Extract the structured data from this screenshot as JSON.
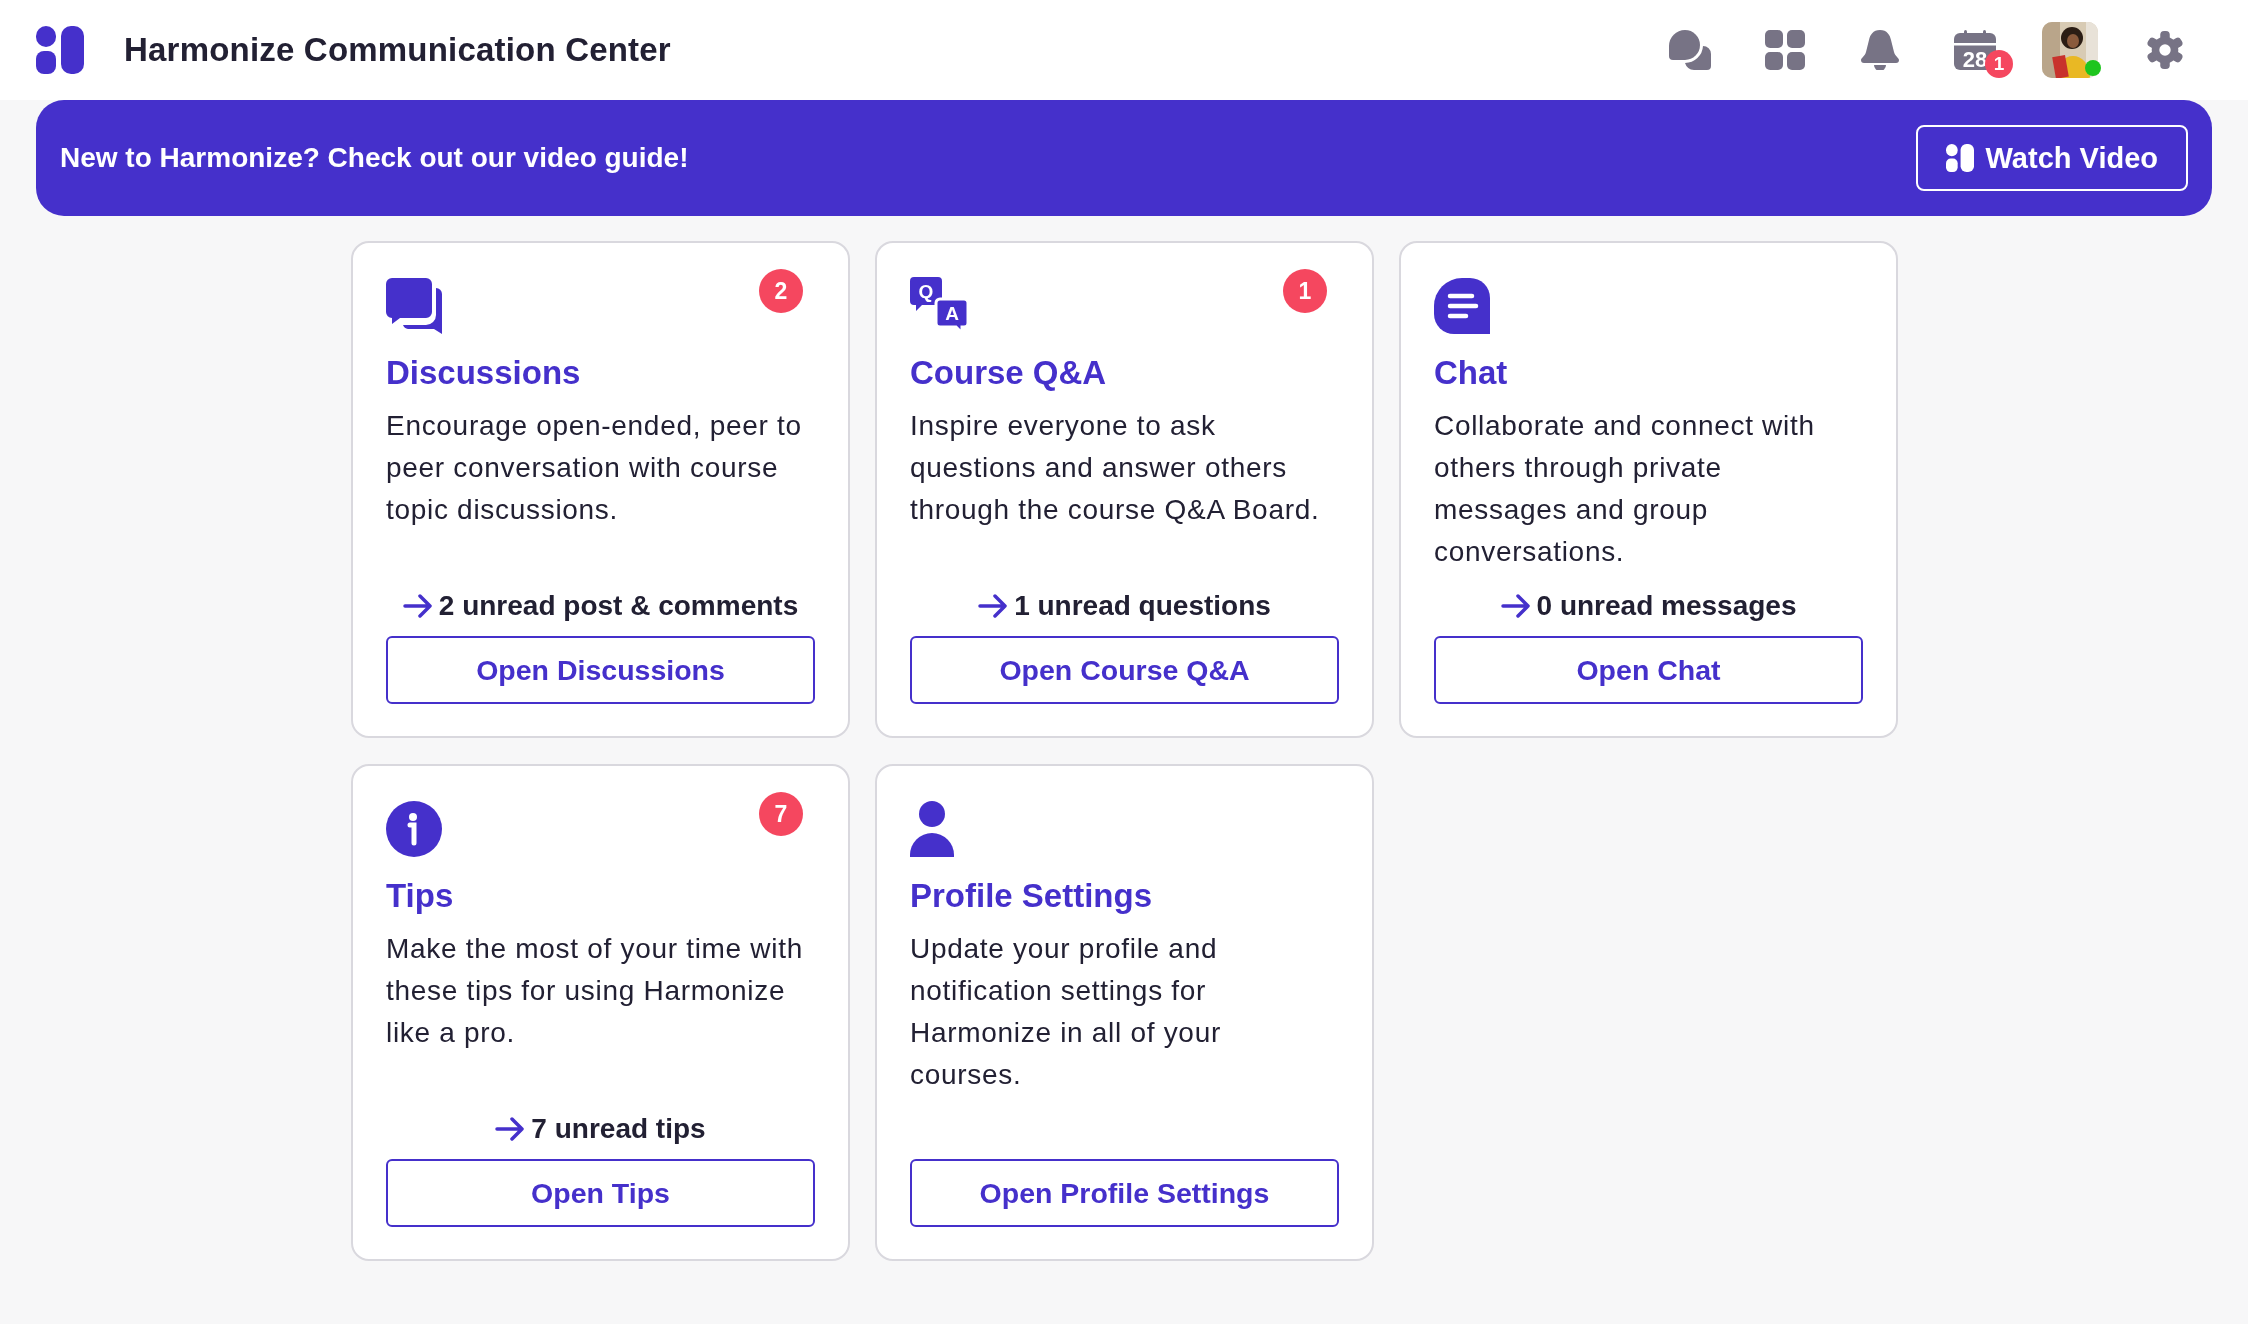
{
  "header": {
    "title": "Harmonize Communication Center",
    "icons": [
      {
        "kind": "chats"
      },
      {
        "kind": "apps"
      },
      {
        "kind": "bell"
      },
      {
        "kind": "calendar",
        "text": "28",
        "badge": "1"
      },
      {
        "kind": "avatar",
        "online": true
      },
      {
        "kind": "settings"
      }
    ]
  },
  "banner": {
    "text": "New to Harmonize? Check out our video guide!",
    "button": "Watch Video"
  },
  "cards": [
    {
      "kind": "discussions",
      "badge": "2",
      "title": "Discussions",
      "description": "Encourage open-ended, peer to peer conversation with course topic discussions.",
      "unread": "2 unread post & comments",
      "button": "Open Discussions"
    },
    {
      "kind": "qa",
      "icon_text": [
        "Q",
        "A"
      ],
      "badge": "1",
      "title": "Course Q&A",
      "description": "Inspire everyone to ask questions and answer others through the course Q&A Board.",
      "unread": "1 unread questions",
      "button": "Open Course Q&A"
    },
    {
      "kind": "chat",
      "title": "Chat",
      "description": "Collaborate and connect with others through private messages and group conversations.",
      "unread": "0 unread messages",
      "button": "Open Chat"
    },
    {
      "kind": "info",
      "badge": "7",
      "title": "Tips",
      "description": "Make the most of your time with these tips for using Harmonize like a pro.",
      "unread": "7 unread tips",
      "button": "Open Tips"
    },
    {
      "kind": "person",
      "title": "Profile Settings",
      "description": "Update your profile and notification settings for Harmonize in all of your courses.",
      "button": "Open Profile Settings"
    }
  ]
}
